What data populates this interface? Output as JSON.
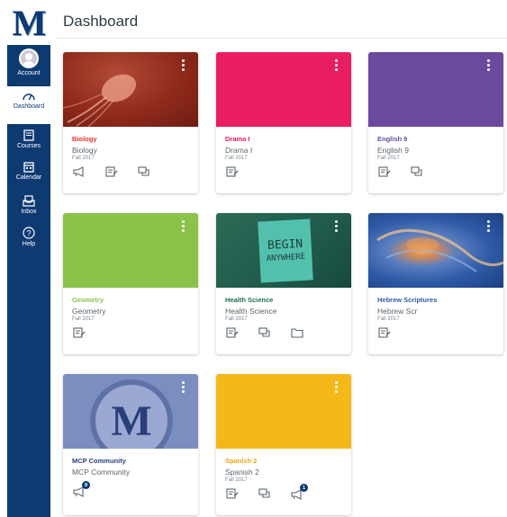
{
  "brand": {
    "logo_letter": "M"
  },
  "nav": {
    "account": "Account",
    "dashboard": "Dashboard",
    "courses": "Courses",
    "calendar": "Calendar",
    "inbox": "Inbox",
    "help": "Help"
  },
  "page": {
    "title": "Dashboard"
  },
  "cards": [
    {
      "code": "Biology",
      "name": "Biology",
      "term": "Fall 2017",
      "color": "#e8312d",
      "icons": [
        "announcements-icon",
        "assignments-icon",
        "discussions-icon"
      ]
    },
    {
      "code": "Drama I",
      "name": "Drama I",
      "term": "Fall 2017",
      "color": "#e81d64",
      "icons": [
        "assignments-icon"
      ]
    },
    {
      "code": "English 9",
      "name": "English 9",
      "term": "Fall 2017",
      "color": "#6b4a9e",
      "icons": [
        "assignments-icon",
        "discussions-icon"
      ]
    },
    {
      "code": "Geometry",
      "name": "Geometry",
      "term": "Fall 2017",
      "color": "#8bc34a",
      "icons": [
        "assignments-icon"
      ]
    },
    {
      "code": "Health Science",
      "name": "Health Science",
      "term": "Fall 2017",
      "color": "#1a6f5b",
      "hero_text": [
        "BEGIN",
        "ANYWHERE"
      ],
      "icons": [
        "assignments-icon",
        "discussions-icon",
        "files-icon"
      ]
    },
    {
      "code": "Hebrew Scriptures",
      "name": "Hebrew Scr",
      "term": "Fall 2017",
      "color": "#2e5aa6",
      "icons": [
        "assignments-icon"
      ]
    },
    {
      "code": "MCP Community",
      "name": "MCP Community",
      "term": "",
      "color": "#2a3e7a",
      "hero_text": [
        "M"
      ],
      "icons": [
        "announcements-icon"
      ],
      "announcement_badge": "8"
    },
    {
      "code": "Spanish 2",
      "name": "Spanish 2",
      "term": "Fall 2017",
      "color": "#f5b819",
      "icons": [
        "assignments-icon",
        "discussions-icon",
        "announcements-icon"
      ],
      "announcement_badge": "1"
    }
  ]
}
